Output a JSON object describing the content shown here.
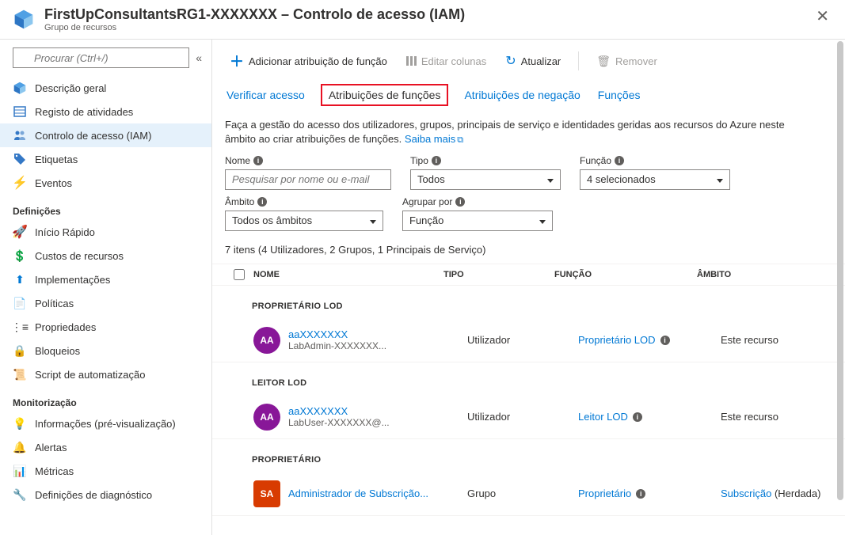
{
  "header": {
    "title": "FirstUpConsultantsRG1-XXXXXXX – Controlo de acesso (IAM)",
    "subtitle": "Grupo de recursos"
  },
  "search": {
    "placeholder": "Procurar (Ctrl+/)"
  },
  "sidebar": {
    "items": [
      {
        "icon": "overview",
        "label": "Descrição geral"
      },
      {
        "icon": "activity",
        "label": "Registo de atividades"
      },
      {
        "icon": "iam",
        "label": "Controlo de acesso (IAM)",
        "active": true
      },
      {
        "icon": "tags",
        "label": "Etiquetas"
      },
      {
        "icon": "events",
        "label": "Eventos"
      }
    ],
    "sections": [
      {
        "label": "Definições",
        "items": [
          {
            "icon": "quickstart",
            "label": "Início Rápido"
          },
          {
            "icon": "cost",
            "label": "Custos de recursos"
          },
          {
            "icon": "deploy",
            "label": "Implementações"
          },
          {
            "icon": "policy",
            "label": "Políticas"
          },
          {
            "icon": "props",
            "label": "Propriedades"
          },
          {
            "icon": "locks",
            "label": "Bloqueios"
          },
          {
            "icon": "script",
            "label": "Script de automatização"
          }
        ]
      },
      {
        "label": "Monitorização",
        "items": [
          {
            "icon": "insights",
            "label": "Informações (pré-visualização)"
          },
          {
            "icon": "alerts",
            "label": "Alertas"
          },
          {
            "icon": "metrics",
            "label": "Métricas"
          },
          {
            "icon": "diag",
            "label": "Definições de diagnóstico"
          }
        ]
      }
    ]
  },
  "toolbar": {
    "add": "Adicionar atribuição de função",
    "columns": "Editar colunas",
    "refresh": "Atualizar",
    "remove": "Remover"
  },
  "tabs": {
    "check": "Verificar acesso",
    "assignments": "Atribuições de funções",
    "deny": "Atribuições de negação",
    "roles": "Funções"
  },
  "description": {
    "text": "Faça a gestão do acesso dos utilizadores, grupos, principais de serviço e identidades geridas aos recursos do Azure neste âmbito ao criar atribuições de funções.",
    "more": "Saiba mais"
  },
  "filters": {
    "name_label": "Nome",
    "name_placeholder": "Pesquisar por nome ou e-mail",
    "type_label": "Tipo",
    "type_value": "Todos",
    "role_label": "Função",
    "role_value": "4 selecionados",
    "scope_label": "Âmbito",
    "scope_value": "Todos os âmbitos",
    "group_label": "Agrupar por",
    "group_value": "Função"
  },
  "count": "7 itens (4 Utilizadores, 2 Grupos, 1 Principais de Serviço)",
  "columns": {
    "name": "NOME",
    "type": "TIPO",
    "role": "FUNÇÃO",
    "scope": "ÂMBITO"
  },
  "groups": [
    {
      "label": "PROPRIETÁRIO LOD",
      "rows": [
        {
          "avatar": "AA",
          "avclass": "purple",
          "name": "aaXXXXXXX",
          "sub": "LabAdmin-XXXXXXX...",
          "type": "Utilizador",
          "role": "Proprietário LOD",
          "roleinfo": true,
          "scope": "Este recurso",
          "scope_link": false,
          "inherited": ""
        }
      ]
    },
    {
      "label": "LEITOR LOD",
      "rows": [
        {
          "avatar": "AA",
          "avclass": "purple",
          "name": "aaXXXXXXX",
          "sub": "LabUser-XXXXXXX@...",
          "type": "Utilizador",
          "role": "Leitor LOD",
          "roleinfo": true,
          "scope": "Este recurso",
          "scope_link": false,
          "inherited": ""
        }
      ]
    },
    {
      "label": "PROPRIETÁRIO",
      "rows": [
        {
          "avatar": "SA",
          "avclass": "red",
          "name": "Administrador de Subscrição...",
          "sub": "",
          "type": "Grupo",
          "role": "Proprietário",
          "roleinfo": true,
          "scope": "Subscrição",
          "scope_link": true,
          "inherited": "(Herdada)"
        }
      ]
    }
  ]
}
